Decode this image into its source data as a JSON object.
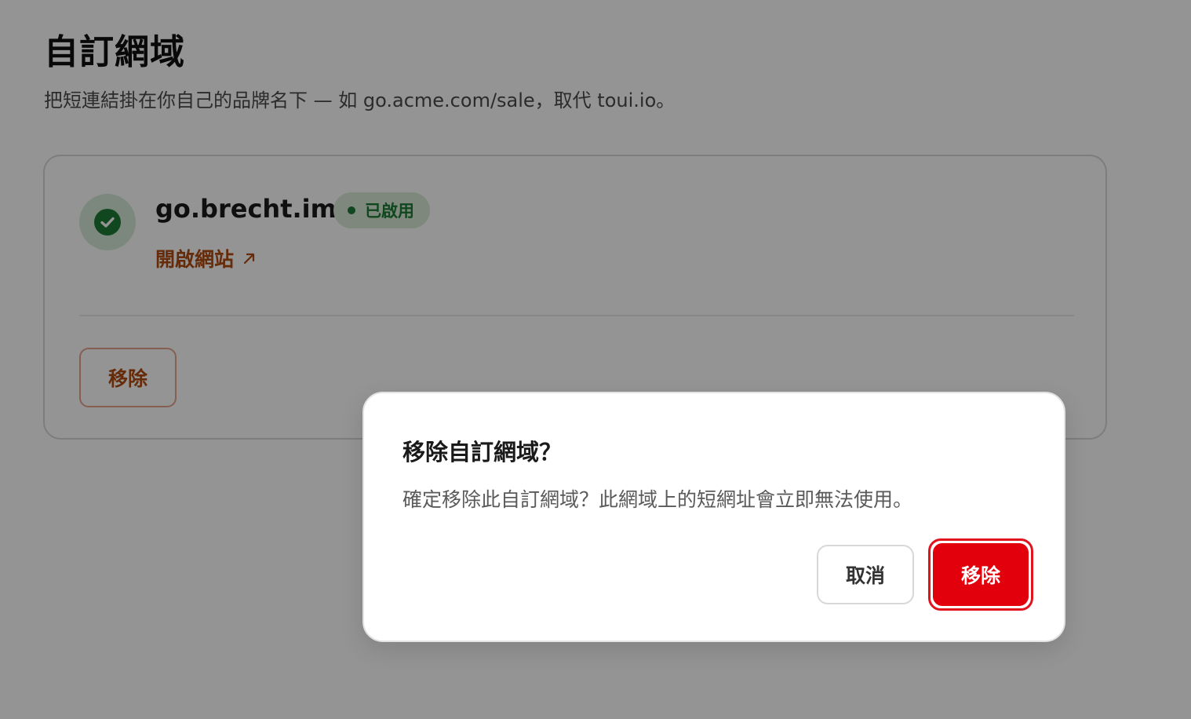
{
  "page": {
    "title": "自訂網域",
    "subtitle": "把短連結掛在你自己的品牌名下 — 如 go.acme.com/sale，取代 toui.io。"
  },
  "domain_card": {
    "domain": "go.brecht.im",
    "status": "已啟用",
    "open_link_label": "開啟網站",
    "remove_label": "移除",
    "icons": {
      "status": "check-circle-icon",
      "link": "arrow-up-right-icon"
    },
    "colors": {
      "status_green": "#1e7b34",
      "link_orange": "#b04a10"
    }
  },
  "dialog": {
    "title": "移除自訂網域？",
    "message": "確定移除此自訂網域？此網域上的短網址會立即無法使用。",
    "cancel_label": "取消",
    "confirm_label": "移除",
    "colors": {
      "danger": "#e2000c"
    }
  }
}
